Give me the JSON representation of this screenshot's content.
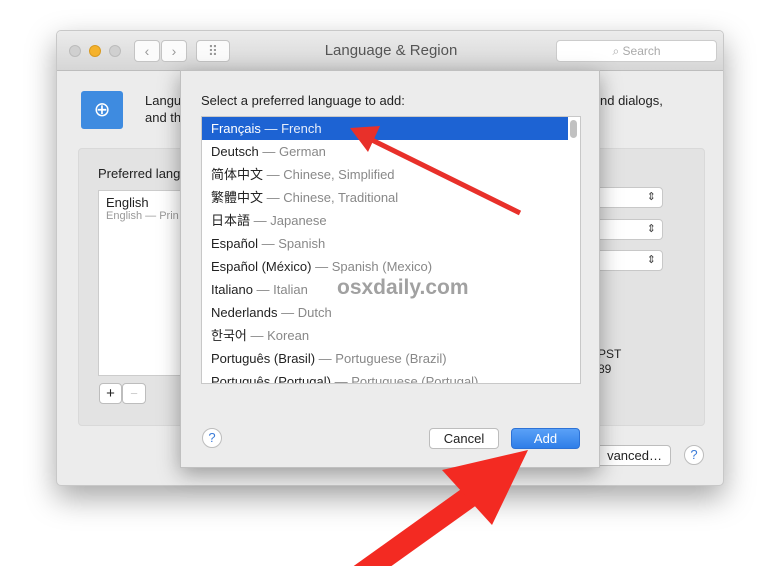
{
  "window": {
    "title": "Language & Region",
    "search_placeholder": "Search",
    "back": "‹",
    "forward": "›",
    "grid": "⠿",
    "description_line1": "Langu",
    "description_line2": "and th",
    "description_right": "nd dialogs,",
    "preferred_label": "Preferred lang",
    "preferred_items": [
      {
        "name": "English",
        "detail": "English — Prin"
      }
    ],
    "add": "+",
    "remove": "−",
    "time_zone_partial": "PST",
    "number_partial": "89",
    "advanced_partial": "vanced…",
    "help": "?"
  },
  "sheet": {
    "prompt": "Select a preferred language to add:",
    "languages": [
      {
        "native": "Français",
        "english": "French",
        "selected": true
      },
      {
        "native": "Deutsch",
        "english": "German"
      },
      {
        "native": "简体中文",
        "english": "Chinese, Simplified"
      },
      {
        "native": "繁體中文",
        "english": "Chinese, Traditional"
      },
      {
        "native": "日本語",
        "english": "Japanese"
      },
      {
        "native": "Español",
        "english": "Spanish"
      },
      {
        "native": "Español (México)",
        "english": "Spanish (Mexico)"
      },
      {
        "native": "Italiano",
        "english": "Italian"
      },
      {
        "native": "Nederlands",
        "english": "Dutch"
      },
      {
        "native": "한국어",
        "english": "Korean"
      },
      {
        "native": "Português (Brasil)",
        "english": "Portuguese (Brazil)"
      },
      {
        "native": "Português (Portugal)",
        "english": "Portuguese (Portugal)"
      }
    ],
    "separator": "—",
    "cancel": "Cancel",
    "add": "Add",
    "help": "?"
  },
  "watermark": "osxdaily.com",
  "colors": {
    "selection": "#1d63d3",
    "add_button": "#3a8bf2",
    "arrow": "#e8302a"
  }
}
